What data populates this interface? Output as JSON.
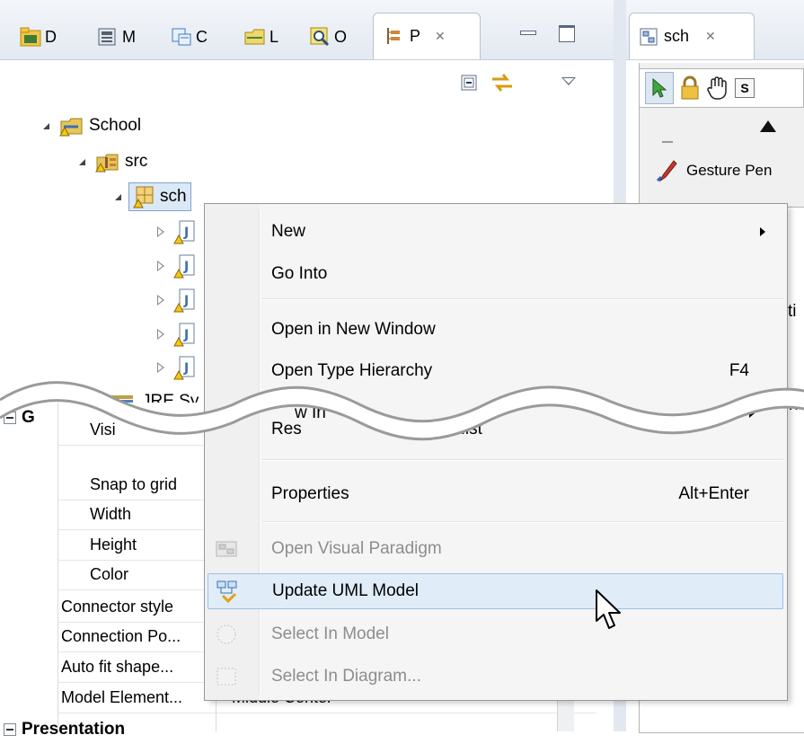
{
  "left_view": {
    "tabs": [
      {
        "label": "D"
      },
      {
        "label": "M"
      },
      {
        "label": "C"
      },
      {
        "label": "L"
      },
      {
        "label": "O"
      }
    ],
    "active_tab": {
      "label": "P",
      "close": "✕"
    },
    "tree": {
      "root": "School",
      "src": "src",
      "package": "sch",
      "jre": "JRE Sy"
    }
  },
  "properties": {
    "group_label": "G",
    "rows": [
      {
        "label": "Visi"
      },
      {
        "label": "Snap to grid"
      },
      {
        "label": "Width"
      },
      {
        "label": "Height"
      },
      {
        "label": "Color"
      },
      {
        "label": "Connector style"
      },
      {
        "label": "Connection Po..."
      },
      {
        "label": "Auto fit shape..."
      },
      {
        "label": "Model Element..."
      }
    ],
    "partial_value": "Middle Center",
    "presentation_label": "Presentation"
  },
  "right_view": {
    "tab_label": "sch",
    "tab_close": "✕",
    "palette_s": "S",
    "gesture_label": "Gesture Pen",
    "partial_right_1": "ti",
    "partial_right_2": "n"
  },
  "context_menu": {
    "items": {
      "new": "New",
      "go_into": "Go Into",
      "open_new_window": "Open in New Window",
      "open_type_hierarchy": "Open Type Hierarchy",
      "open_type_hierarchy_shortcut": "F4",
      "show_in": "w In",
      "show_in_shortcut": "-W",
      "restore": "Res",
      "restore_tail": "ocal Hist",
      "properties": "Properties",
      "properties_shortcut": "Alt+Enter",
      "open_vp": "Open Visual Paradigm",
      "update_uml": "Update UML Model",
      "select_model": "Select In Model",
      "select_diagram": "Select In Diagram..."
    }
  },
  "colors": {
    "selection": "#e0ecf8",
    "selection_border": "#9ec0e5",
    "tab_gradient_top": "#f3f6fa",
    "tab_gradient_bottom": "#e3e9f1"
  }
}
